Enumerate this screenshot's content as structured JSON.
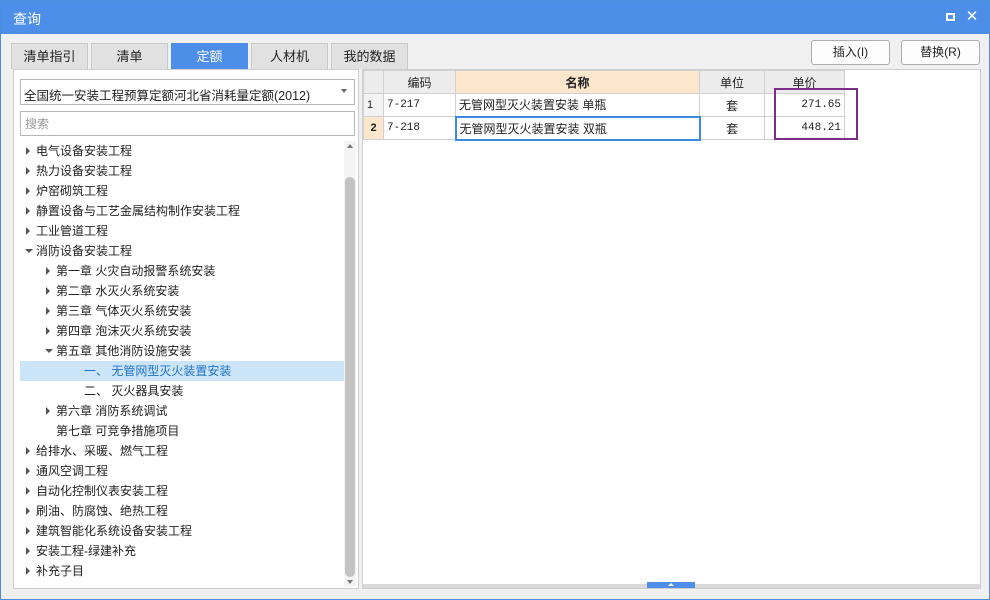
{
  "window": {
    "title": "查询",
    "maximize_icon": "maximize-icon",
    "close_icon": "close-icon",
    "close_glyph": "✕"
  },
  "tabs": [
    {
      "label": "清单指引",
      "active": false
    },
    {
      "label": "清单",
      "active": false
    },
    {
      "label": "定额",
      "active": true
    },
    {
      "label": "人材机",
      "active": false
    },
    {
      "label": "我的数据",
      "active": false
    }
  ],
  "toolbar": {
    "insert_label": "插入(I)",
    "replace_label": "替换(R)"
  },
  "left": {
    "library_selected": "全国统一安装工程预算定额河北省消耗量定额(2012)",
    "search_placeholder": "搜索",
    "tree": [
      {
        "label": "电气设备安装工程",
        "toggle": "collapsed"
      },
      {
        "label": "热力设备安装工程",
        "toggle": "collapsed"
      },
      {
        "label": "炉窑砌筑工程",
        "toggle": "collapsed"
      },
      {
        "label": "静置设备与工艺金属结构制作安装工程",
        "toggle": "collapsed"
      },
      {
        "label": "工业管道工程",
        "toggle": "collapsed"
      },
      {
        "label": "消防设备安装工程",
        "toggle": "expanded"
      },
      {
        "label": "第一章 火灾自动报警系统安装",
        "toggle": "collapsed"
      },
      {
        "label": "第二章 水灭火系统安装",
        "toggle": "collapsed"
      },
      {
        "label": "第三章 气体灭火系统安装",
        "toggle": "collapsed"
      },
      {
        "label": "第四章 泡沫灭火系统安装",
        "toggle": "collapsed"
      },
      {
        "label": "第五章 其他消防设施安装",
        "toggle": "expanded"
      },
      {
        "label": "一、 无管网型灭火装置安装",
        "toggle": "none",
        "selected": true
      },
      {
        "label": "二、 灭火器具安装",
        "toggle": "none"
      },
      {
        "label": "第六章 消防系统调试",
        "toggle": "collapsed"
      },
      {
        "label": "第七章 可竞争措施项目",
        "toggle": "none"
      },
      {
        "label": "给排水、采暖、燃气工程",
        "toggle": "collapsed"
      },
      {
        "label": "通风空调工程",
        "toggle": "collapsed"
      },
      {
        "label": "自动化控制仪表安装工程",
        "toggle": "collapsed"
      },
      {
        "label": "刷油、防腐蚀、绝热工程",
        "toggle": "collapsed"
      },
      {
        "label": "建筑智能化系统设备安装工程",
        "toggle": "collapsed"
      },
      {
        "label": "安装工程-绿建补充",
        "toggle": "collapsed"
      },
      {
        "label": "补充子目",
        "toggle": "collapsed"
      }
    ]
  },
  "grid": {
    "headers": {
      "code": "编码",
      "name": "名称",
      "unit": "单位",
      "price": "单价"
    },
    "rows": [
      {
        "no": "1",
        "code": "7-217",
        "name": "无管网型灭火装置安装 单瓶",
        "unit": "套",
        "price": "271.65"
      },
      {
        "no": "2",
        "code": "7-218",
        "name": "无管网型灭火装置安装 双瓶",
        "unit": "套",
        "price": "448.21",
        "current": true
      }
    ],
    "price_highlight_color": "#7b2d87"
  },
  "colors": {
    "accent": "#4d8fe8",
    "selected_row": "#cce4f7",
    "header_highlight": "#fde7cc"
  }
}
